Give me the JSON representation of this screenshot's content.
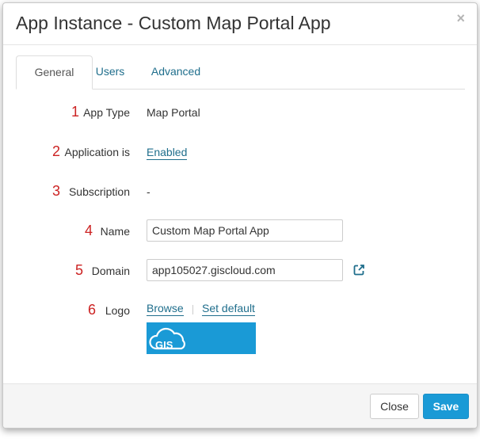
{
  "header": {
    "title": "App Instance - Custom Map Portal App",
    "close_symbol": "×"
  },
  "tabs": [
    {
      "label": "General",
      "active": true
    },
    {
      "label": "Users",
      "active": false
    },
    {
      "label": "Advanced",
      "active": false
    }
  ],
  "form": {
    "app_type": {
      "num": "1",
      "label": "App Type",
      "value": "Map Portal"
    },
    "application": {
      "num": "2",
      "label": "Application is",
      "value": "Enabled"
    },
    "subscription": {
      "num": "3",
      "label": "Subscription",
      "value": "-"
    },
    "name": {
      "num": "4",
      "label": "Name",
      "value": "Custom Map Portal App"
    },
    "domain": {
      "num": "5",
      "label": "Domain",
      "value": "app105027.giscloud.com",
      "open_icon": "external-link-icon"
    },
    "logo": {
      "num": "6",
      "label": "Logo",
      "browse": "Browse",
      "set_default": "Set default",
      "logo_text": "GIS",
      "logo_color": "#1a9ad6"
    }
  },
  "footer": {
    "close_label": "Close",
    "save_label": "Save"
  },
  "colors": {
    "accent": "#1a9ad6",
    "link": "#1f6e8c",
    "number": "#cc2222"
  }
}
